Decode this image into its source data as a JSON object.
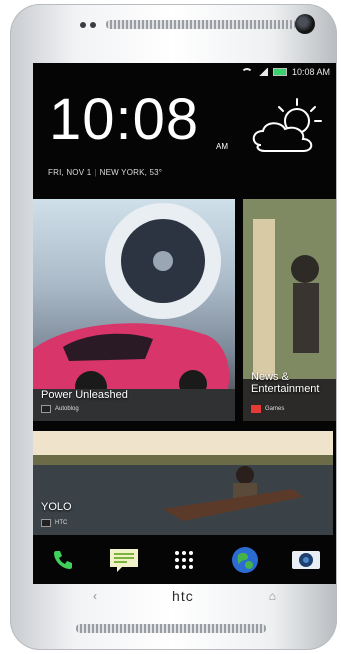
{
  "status": {
    "time": "10:08 AM"
  },
  "lockscreen": {
    "clock": "10:08",
    "ampm": "AM",
    "date": "FRI, NOV 1",
    "location": "NEW YORK, 53°"
  },
  "tiles": [
    {
      "title": "Power Unleashed",
      "source": "Autoblog"
    },
    {
      "title": "News & Entertainment",
      "source": "Games"
    },
    {
      "title": "YOLO",
      "source": "HTC"
    }
  ],
  "dock": [
    "phone-icon",
    "messages-icon",
    "apps-icon",
    "browser-icon",
    "camera-icon"
  ],
  "brand": "htc",
  "colors": {
    "battery": "#3bd16f",
    "accent": "#2c6bd1"
  }
}
